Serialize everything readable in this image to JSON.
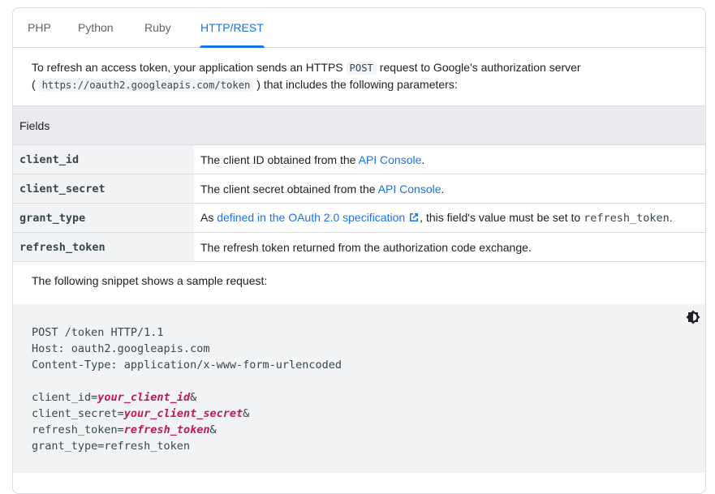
{
  "tabs": [
    {
      "label": "PHP"
    },
    {
      "label": "Python"
    },
    {
      "label": "Ruby"
    },
    {
      "label": "HTTP/REST"
    }
  ],
  "intro": {
    "text_before": "To refresh an access token, your application sends an HTTPS ",
    "method": "POST",
    "text_middle": " request to Google's authorization server",
    "open_paren": "(",
    "endpoint": "https://oauth2.googleapis.com/token",
    "text_after": ") that includes the following parameters:"
  },
  "fields_table": {
    "header": "Fields",
    "rows": [
      {
        "name": "client_id",
        "desc_before": "The client ID obtained from the ",
        "link": "API Console",
        "desc_after": "."
      },
      {
        "name": "client_secret",
        "desc_before": "The client secret obtained from the ",
        "link": "API Console",
        "desc_after": "."
      },
      {
        "name": "grant_type",
        "desc_before": "As ",
        "link": "defined in the OAuth 2.0 specification",
        "desc_middle": ", this field's value must be set to ",
        "code": "refresh_token",
        "desc_after": "."
      },
      {
        "name": "refresh_token",
        "desc": "The refresh token returned from the authorization code exchange."
      }
    ]
  },
  "snippet": {
    "intro": "The following snippet shows a sample request:",
    "lines": {
      "l1": "POST /token HTTP/1.1",
      "l2": "Host: oauth2.googleapis.com",
      "l3": "Content-Type: application/x-www-form-urlencoded",
      "l5_key": "client_id=",
      "l5_var": "your_client_id",
      "l5_end": "&",
      "l6_key": "client_secret=",
      "l6_var": "your_client_secret",
      "l6_end": "&",
      "l7_key": "refresh_token=",
      "l7_var": "refresh_token",
      "l7_end": "&",
      "l8": "grant_type=refresh_token"
    },
    "theme_icon": "theme-toggle-icon"
  },
  "colors": {
    "accent": "#1a73e8",
    "code_var": "#c2185b",
    "header_bg": "#e8eaed",
    "code_bg": "#f1f3f4"
  }
}
